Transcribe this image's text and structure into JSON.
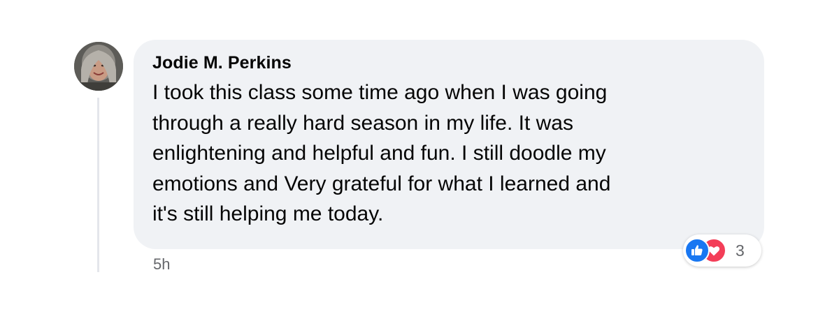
{
  "comment": {
    "author": "Jodie M. Perkins",
    "text_lines": [
      "I took this class some time ago when I was going",
      "through a really hard season in my life. It was",
      "enlightening and helpful and fun. I still doodle my",
      "emotions and Very grateful for what I learned and",
      "it's still helping me today."
    ],
    "timestamp": "5h",
    "reactions": {
      "icons": [
        "like-icon",
        "love-icon"
      ],
      "count": "3",
      "colors": {
        "like": "#1877f2",
        "love": "#f33e58"
      }
    }
  },
  "colors": {
    "bubble_background": "#f0f2f5",
    "text": "#050505",
    "secondary_text": "#65676b"
  }
}
